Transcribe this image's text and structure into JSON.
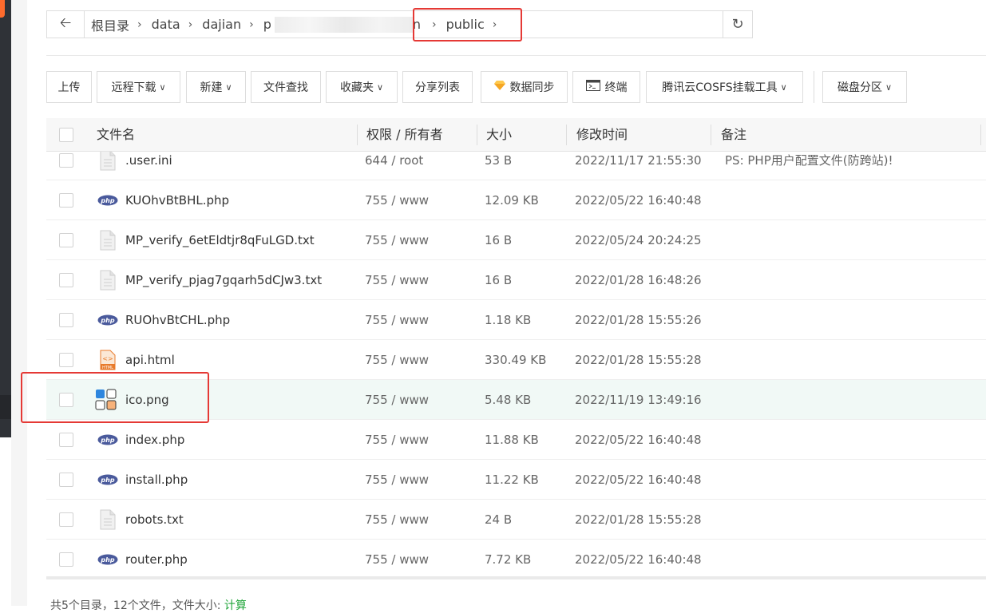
{
  "breadcrumb": {
    "back_icon": "arrow-left-icon",
    "items": [
      "根目录",
      "data",
      "dajian",
      "p",
      "n",
      "public"
    ],
    "refresh_icon": "refresh-icon"
  },
  "toolbar": {
    "upload": "上传",
    "remote_download": "远程下载",
    "new": "新建",
    "file_search": "文件查找",
    "favorites": "收藏夹",
    "share_list": "分享列表",
    "data_sync": "数据同步",
    "terminal": "终端",
    "cosfs": "腾讯云COSFS挂载工具",
    "disk_partition": "磁盘分区"
  },
  "table": {
    "headers": {
      "name": "文件名",
      "perm": "权限 / 所有者",
      "size": "大小",
      "mtime": "修改时间",
      "note": "备注"
    },
    "rows": [
      {
        "name": ".user.ini",
        "icon": "text-file-icon",
        "perm": "644 / root",
        "size": "53 B",
        "mtime": "2022/11/17 21:55:30",
        "note": "PS: PHP用户配置文件(防跨站)!"
      },
      {
        "name": "KUOhvBtBHL.php",
        "icon": "php-file-icon",
        "perm": "755 / www",
        "size": "12.09 KB",
        "mtime": "2022/05/22 16:40:48",
        "note": ""
      },
      {
        "name": "MP_verify_6etEldtjr8qFuLGD.txt",
        "icon": "text-file-icon",
        "perm": "755 / www",
        "size": "16 B",
        "mtime": "2022/05/24 20:24:25",
        "note": ""
      },
      {
        "name": "MP_verify_pjag7gqarh5dCJw3.txt",
        "icon": "text-file-icon",
        "perm": "755 / www",
        "size": "16 B",
        "mtime": "2022/01/28 16:48:26",
        "note": ""
      },
      {
        "name": "RUOhvBtCHL.php",
        "icon": "php-file-icon",
        "perm": "755 / www",
        "size": "1.18 KB",
        "mtime": "2022/01/28 15:55:26",
        "note": ""
      },
      {
        "name": "api.html",
        "icon": "html-file-icon",
        "perm": "755 / www",
        "size": "330.49 KB",
        "mtime": "2022/01/28 15:55:28",
        "note": ""
      },
      {
        "name": "ico.png",
        "icon": "image-file-icon",
        "perm": "755 / www",
        "size": "5.48 KB",
        "mtime": "2022/11/19 13:49:16",
        "note": ""
      },
      {
        "name": "index.php",
        "icon": "php-file-icon",
        "perm": "755 / www",
        "size": "11.88 KB",
        "mtime": "2022/05/22 16:40:48",
        "note": ""
      },
      {
        "name": "install.php",
        "icon": "php-file-icon",
        "perm": "755 / www",
        "size": "11.22 KB",
        "mtime": "2022/05/22 16:40:48",
        "note": ""
      },
      {
        "name": "robots.txt",
        "icon": "text-file-icon",
        "perm": "755 / www",
        "size": "24 B",
        "mtime": "2022/01/28 15:55:28",
        "note": ""
      },
      {
        "name": "router.php",
        "icon": "php-file-icon",
        "perm": "755 / www",
        "size": "7.72 KB",
        "mtime": "2022/05/22 16:40:48",
        "note": ""
      }
    ]
  },
  "footer": {
    "summary": "共5个目录，12个文件，文件大小: ",
    "calc_link": "计算"
  },
  "colors": {
    "highlight_box": "#e53935",
    "link_green": "#20a53a",
    "php_badge": "#4a5a9c",
    "html_badge": "#e87b2c"
  }
}
